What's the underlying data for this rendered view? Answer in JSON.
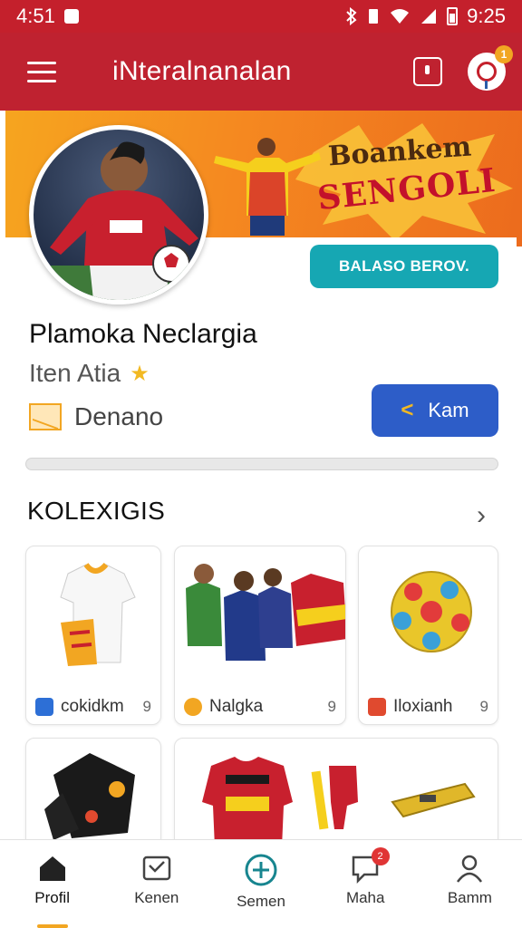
{
  "status_bar": {
    "time_left": "4:51",
    "time_right": "9:25"
  },
  "app_bar": {
    "title": "iNteralnanalan",
    "notification_count": "1"
  },
  "banner": {
    "line1": "Boankem",
    "line2": "SENGOLI"
  },
  "profile": {
    "follow_button": "BALASO BEROV.",
    "name": "Plamoka Neclargia",
    "subtitle": "Iten Atia",
    "location": "Denano",
    "share_button": "Kam"
  },
  "collection": {
    "title": "KOLEXIGIS",
    "items": [
      {
        "label": "cokidkm",
        "count": "9"
      },
      {
        "label": "Nalgka",
        "count": "9"
      },
      {
        "label": "Iloxianh",
        "count": "9"
      }
    ]
  },
  "bottom_nav": {
    "items": [
      {
        "label": "Profil"
      },
      {
        "label": "Kenen"
      },
      {
        "label": "Semen"
      },
      {
        "label": "Maha",
        "badge": "2"
      },
      {
        "label": "Bamm"
      }
    ]
  },
  "colors": {
    "brand_red": "#c4202c",
    "teal": "#16a7b3",
    "blue": "#2d5dc8",
    "accent_orange": "#f2a622"
  }
}
